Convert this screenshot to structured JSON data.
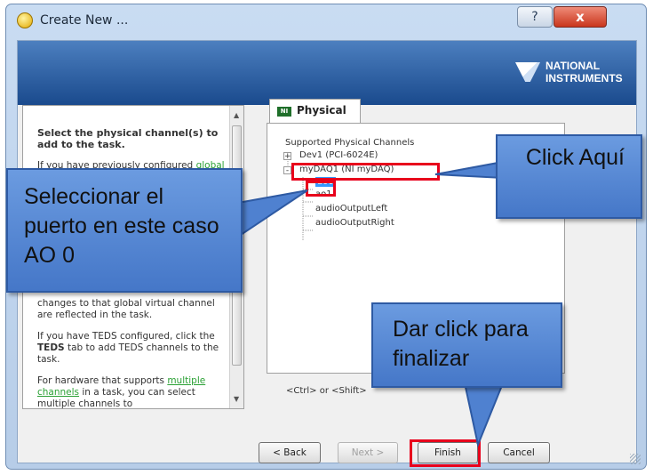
{
  "window": {
    "title": "Create New ...",
    "help_glyph": "?",
    "close_glyph": "x",
    "brand_line1": "NATIONAL",
    "brand_line2": "INSTRUMENTS"
  },
  "instructions": {
    "heading": "Select the physical channel(s) to add to the task.",
    "para1_start": "If you have previously configured ",
    "para1_link": "global virtual",
    "para2": "changes to that global virtual channel are reflected in the task.",
    "para3_start": "If you have TEDS configured, click the ",
    "para3_bold": "TEDS",
    "para3_end": " tab to add TEDS channels to the task.",
    "para4_start": "For hardware that supports ",
    "para4_link": "multiple channels",
    "para4_end": " in a task, you can select multiple channels to"
  },
  "tab": {
    "label": "Physical",
    "icon_text": "NI"
  },
  "channels": {
    "header": "Supported Physical Channels",
    "tree": [
      {
        "label": "Dev1 (PCI-6024E)",
        "expander": "+"
      },
      {
        "label": "myDAQ1 (NI myDAQ)",
        "expander": "-"
      },
      {
        "label": "ao0"
      },
      {
        "label": "ao1"
      },
      {
        "label": "audioOutputLeft"
      },
      {
        "label": "audioOutputRight"
      }
    ],
    "hint": "<Ctrl> or <Shift>"
  },
  "buttons": {
    "back": "< Back",
    "next": "Next >",
    "finish": "Finish",
    "cancel": "Cancel"
  },
  "callouts": {
    "left": "Seleccionar el puerto en este caso AO 0",
    "right": "Click Aquí",
    "bottom": "Dar click para finalizar"
  },
  "colors": {
    "callout_fill": "#5b8ad6",
    "highlight": "#e8001c",
    "banner": "#2a5ca4",
    "link": "#2ba135"
  }
}
